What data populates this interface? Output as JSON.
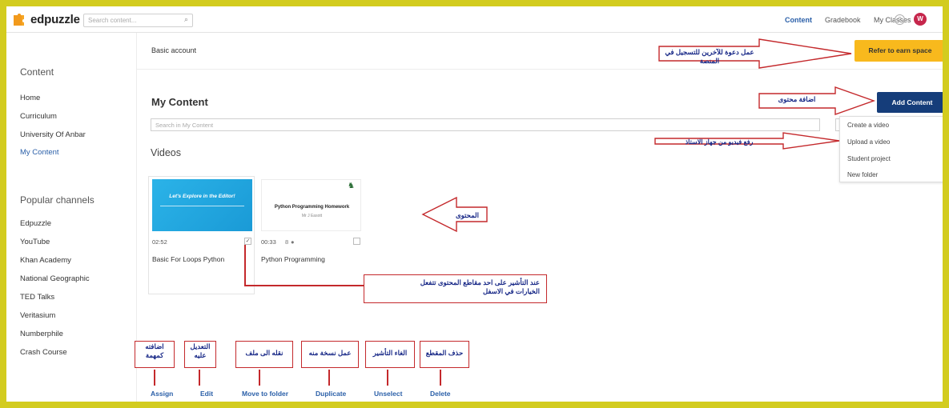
{
  "app": {
    "name": "edpuzzle"
  },
  "topbar": {
    "search_placeholder": "Search content...",
    "nav": [
      "Content",
      "Gradebook",
      "My Classes"
    ],
    "help": "?",
    "avatar_initial": "W"
  },
  "sidebar": {
    "content_heading": "Content",
    "items": [
      "Home",
      "Curriculum",
      "University Of Anbar",
      "My Content"
    ],
    "channels_heading": "Popular channels",
    "channels": [
      "Edpuzzle",
      "YouTube",
      "Khan Academy",
      "National Geographic",
      "TED Talks",
      "Veritasium",
      "Numberphile",
      "Crash Course"
    ]
  },
  "banner": {
    "text": "Basic account",
    "refer_label": "Refer to earn space"
  },
  "main": {
    "title": "My Content",
    "add_label": "Add Content",
    "search_placeholder": "Search in My Content",
    "menu": [
      "Create a video",
      "Upload a video",
      "Student project",
      "New folder"
    ],
    "videos_heading": "Videos",
    "videos": [
      {
        "thumb_text": "Let's Explore in the Editor!",
        "duration": "02:52",
        "title": "Basic For Loops Python",
        "checked": true
      },
      {
        "thumb_title": "Python Programming Homework",
        "thumb_sub": "Mr J Easott",
        "duration": "00:33",
        "badge": "8",
        "title": "Python Programming",
        "checked": false
      }
    ],
    "actions": [
      "Assign",
      "Edit",
      "Move to folder",
      "Duplicate",
      "Unselect",
      "Delete"
    ]
  },
  "annotations": {
    "refer": "عمل دعوة للآخرين للتسجيل في المنصة",
    "add": "اضافة محتوى",
    "upload": "رفع فيديو من جهاز الاستاذ",
    "content": "المحتوى",
    "select_line1": "عند التأشير على احد مقاطع المحتوى تتفعل",
    "select_line2": "الخيارات في الاسفل",
    "assign": "اضافته كمهمة",
    "edit": "التعديل عليه",
    "move": "نقله الى ملف",
    "duplicate": "عمل نسخة منه",
    "unselect": "الغاء التأشير",
    "delete": "حذف المقطع"
  },
  "colors": {
    "frame": "#d3cc1f",
    "accent": "#2a5fa8",
    "refer": "#f8b91d",
    "add": "#153d7a",
    "annotation_border": "#c4292c",
    "annotation_text": "#1a2a88",
    "avatar": "#c6264c"
  }
}
